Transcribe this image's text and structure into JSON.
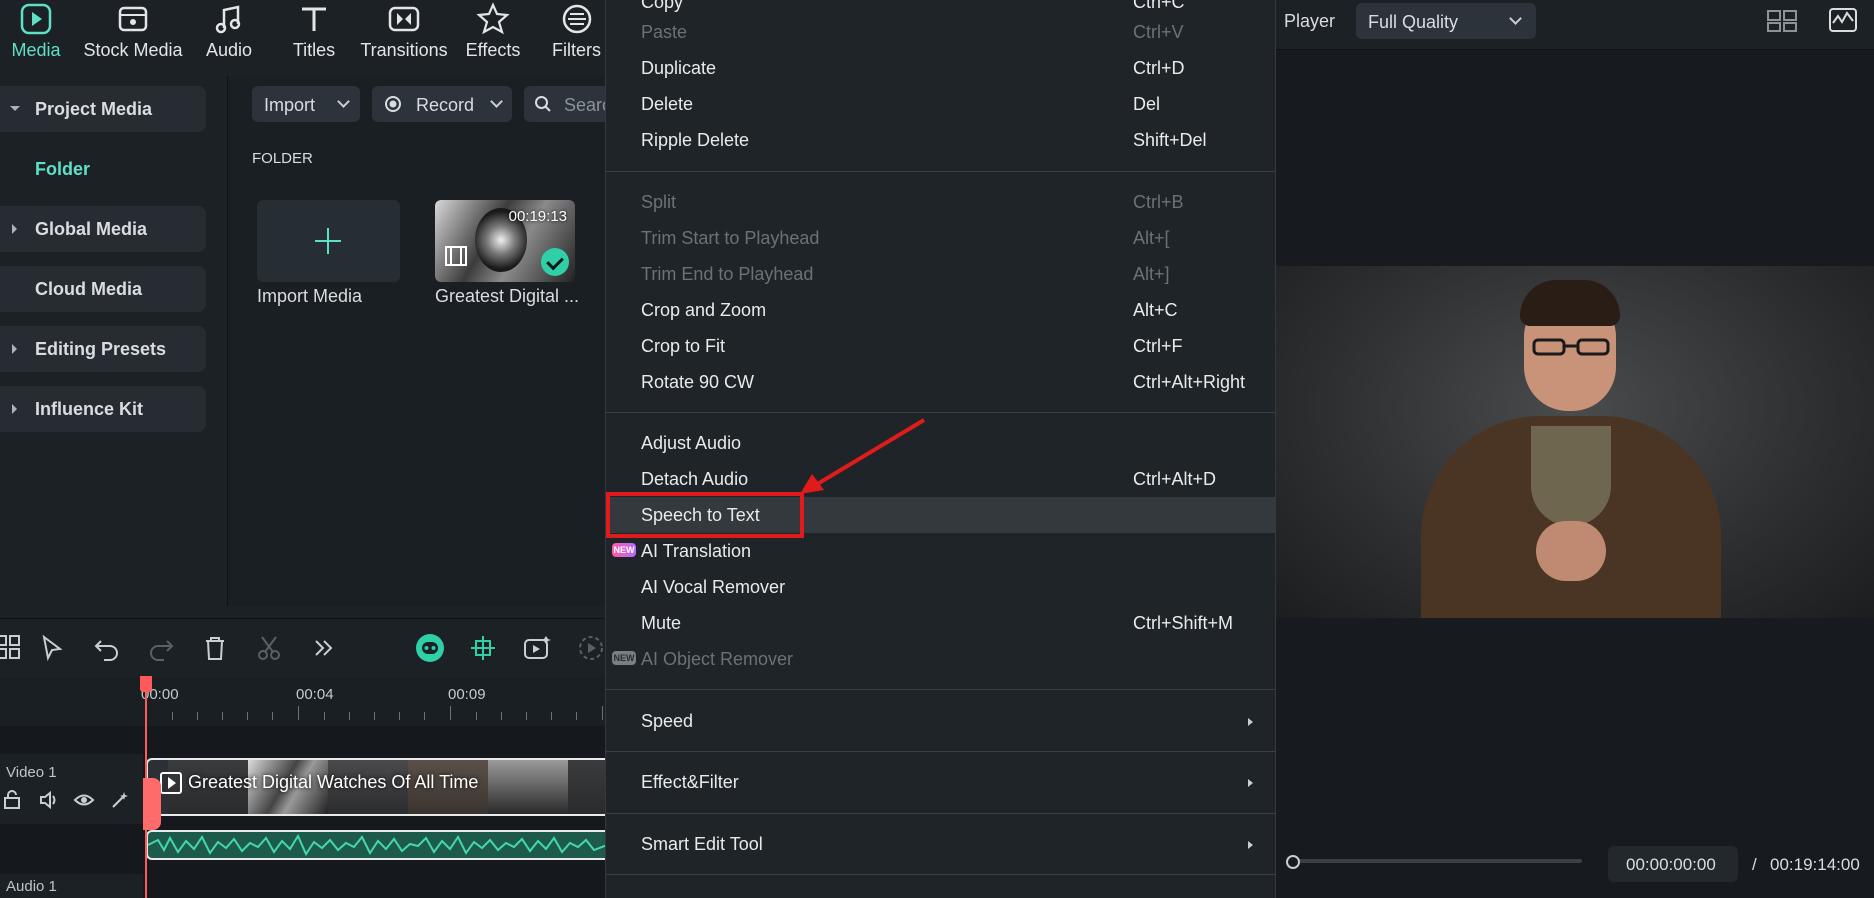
{
  "nav": {
    "items": [
      {
        "label": "Media",
        "icon": "media-icon"
      },
      {
        "label": "Stock Media",
        "icon": "stock-media-icon"
      },
      {
        "label": "Audio",
        "icon": "music-note-icon"
      },
      {
        "label": "Titles",
        "icon": "text-t-icon"
      },
      {
        "label": "Transitions",
        "icon": "transitions-icon"
      },
      {
        "label": "Effects",
        "icon": "effects-star-icon"
      },
      {
        "label": "Filters",
        "icon": "filters-icon"
      }
    ]
  },
  "sidebar": {
    "items": [
      {
        "label": "Project Media"
      },
      {
        "label": "Folder"
      },
      {
        "label": "Global Media"
      },
      {
        "label": "Cloud Media"
      },
      {
        "label": "Editing Presets"
      },
      {
        "label": "Influence Kit"
      }
    ]
  },
  "media": {
    "import_label": "Import",
    "record_label": "Record",
    "search_placeholder": "Search",
    "folder_heading": "FOLDER",
    "import_card_label": "Import Media",
    "clip_card_label": "Greatest Digital ...",
    "clip_duration": "00:19:13"
  },
  "timeline": {
    "ruler": [
      "00:00",
      "00:04",
      "00:09"
    ],
    "video_track_label": "Video 1",
    "audio_track_label": "Audio 1",
    "clip_title": "Greatest Digital Watches Of All Time"
  },
  "menu": {
    "items": [
      {
        "label": "Copy",
        "shortcut": "Ctrl+C",
        "disabled": false
      },
      {
        "label": "Paste",
        "shortcut": "Ctrl+V",
        "disabled": true
      },
      {
        "label": "Duplicate",
        "shortcut": "Ctrl+D",
        "disabled": false
      },
      {
        "label": "Delete",
        "shortcut": "Del",
        "disabled": false
      },
      {
        "label": "Ripple Delete",
        "shortcut": "Shift+Del",
        "disabled": false
      },
      {
        "label": "Split",
        "shortcut": "Ctrl+B",
        "disabled": true
      },
      {
        "label": "Trim Start to Playhead",
        "shortcut": "Alt+[",
        "disabled": true
      },
      {
        "label": "Trim End to Playhead",
        "shortcut": "Alt+]",
        "disabled": true
      },
      {
        "label": "Crop and Zoom",
        "shortcut": "Alt+C",
        "disabled": false
      },
      {
        "label": "Crop to Fit",
        "shortcut": "Ctrl+F",
        "disabled": false
      },
      {
        "label": "Rotate 90 CW",
        "shortcut": "Ctrl+Alt+Right",
        "disabled": false
      },
      {
        "label": "Adjust Audio",
        "shortcut": "",
        "disabled": false
      },
      {
        "label": "Detach Audio",
        "shortcut": "Ctrl+Alt+D",
        "disabled": false
      },
      {
        "label": "Speech to Text",
        "shortcut": "",
        "disabled": false
      },
      {
        "label": "AI Translation",
        "shortcut": "",
        "disabled": false
      },
      {
        "label": "AI Vocal Remover",
        "shortcut": "",
        "disabled": false
      },
      {
        "label": "Mute",
        "shortcut": "Ctrl+Shift+M",
        "disabled": false
      },
      {
        "label": "AI Object Remover",
        "shortcut": "",
        "disabled": true
      },
      {
        "label": "Speed",
        "shortcut": "",
        "disabled": false
      },
      {
        "label": "Effect&Filter",
        "shortcut": "",
        "disabled": false
      },
      {
        "label": "Smart Edit Tool",
        "shortcut": "",
        "disabled": false
      }
    ],
    "new_badge": "NEW"
  },
  "player": {
    "title": "Player",
    "quality": "Full Quality",
    "current_time": "00:00:00:00",
    "separator": "/",
    "total_time": "00:19:14:00"
  },
  "colors": {
    "accent": "#5fe0c6",
    "highlight_box": "#e01b1b",
    "playhead": "#ff5a5a"
  }
}
